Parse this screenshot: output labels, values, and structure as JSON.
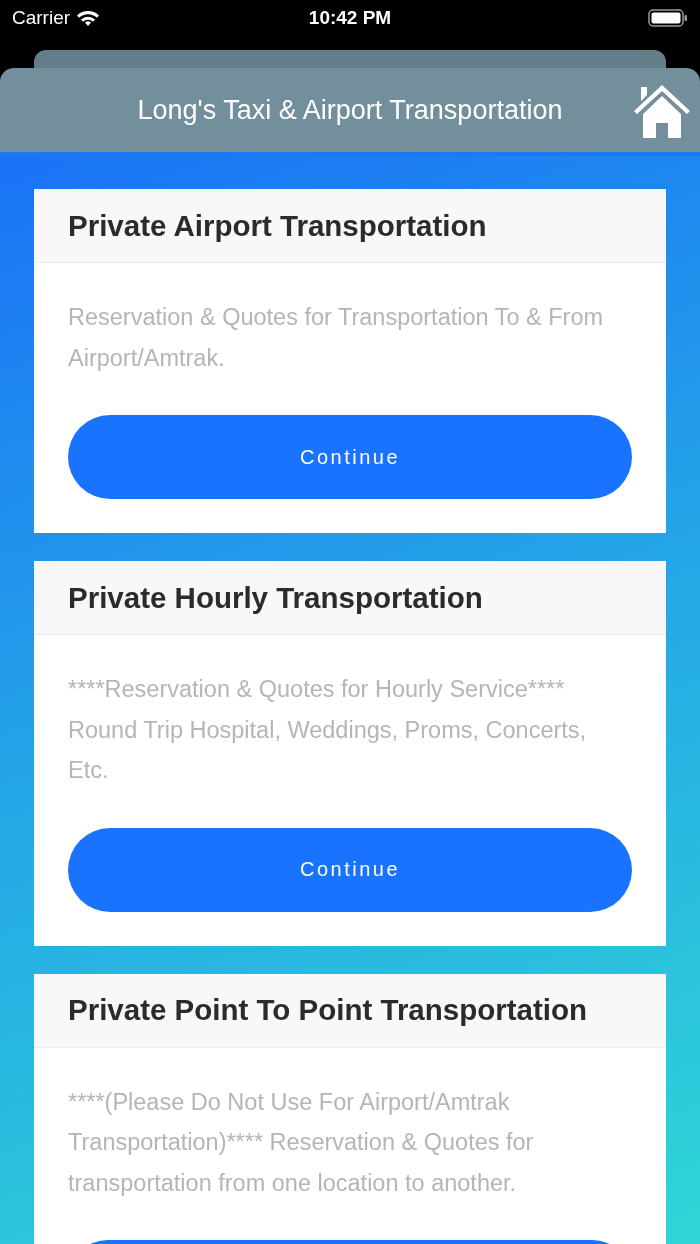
{
  "status_bar": {
    "carrier": "Carrier",
    "time": "10:42 PM"
  },
  "header": {
    "title": "Long's Taxi & Airport Transportation"
  },
  "cards": [
    {
      "title": "Private Airport Transportation",
      "description": "Reservation & Quotes for Transportation To & From Airport/Amtrak.",
      "button": {
        "label": "Continue"
      }
    },
    {
      "title": "Private Hourly Transportation",
      "description": "****Reservation & Quotes for Hourly Service**** Round Trip Hospital, Weddings, Proms, Concerts, Etc.",
      "button": {
        "label": "Continue"
      }
    },
    {
      "title": "Private Point To Point Transportation",
      "description": "****(Please Do Not Use For Airport/Amtrak Transportation)**** Reservation & Quotes for transportation from one location to another.",
      "button": {
        "cut_off": true
      }
    }
  ]
}
